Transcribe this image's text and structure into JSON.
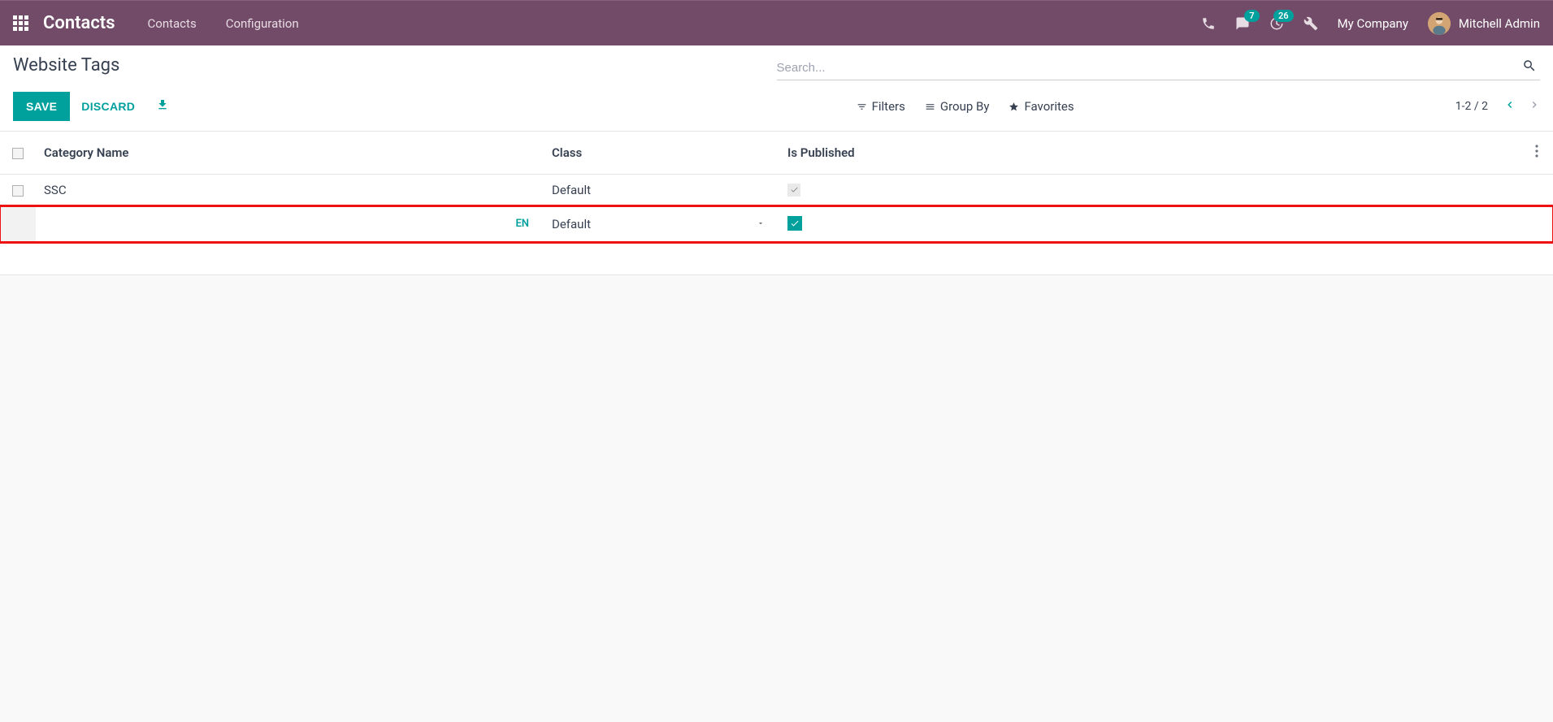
{
  "nav": {
    "brand": "Contacts",
    "menu": {
      "contacts": "Contacts",
      "configuration": "Configuration"
    },
    "badges": {
      "messages": "7",
      "activities": "26"
    },
    "company": "My Company",
    "user": "Mitchell Admin"
  },
  "page": {
    "title": "Website Tags",
    "save": "SAVE",
    "discard": "DISCARD"
  },
  "search": {
    "placeholder": "Search...",
    "filters": "Filters",
    "groupby": "Group By",
    "favorites": "Favorites"
  },
  "pager": {
    "text": "1-2 / 2"
  },
  "table": {
    "headers": {
      "name": "Category Name",
      "class": "Class",
      "published": "Is Published"
    },
    "rows": [
      {
        "name": "SSC",
        "class": "Default",
        "published": true
      }
    ],
    "edit": {
      "name": "",
      "lang": "EN",
      "class": "Default",
      "published": true
    }
  }
}
